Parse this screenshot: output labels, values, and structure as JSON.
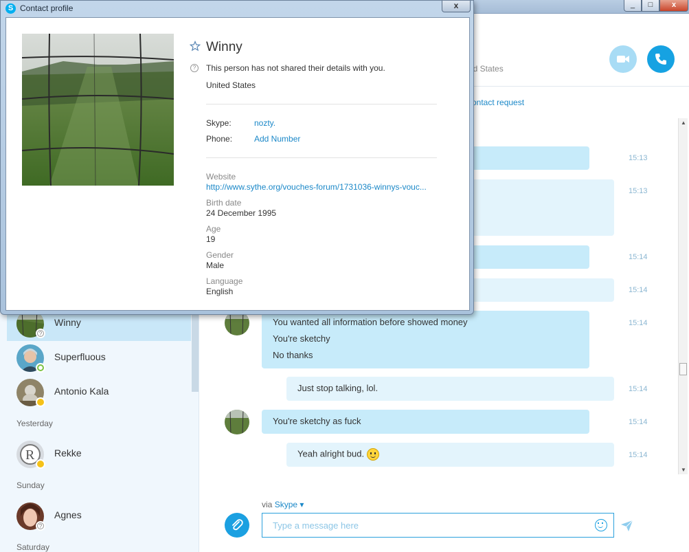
{
  "dialog": {
    "title": "Contact profile",
    "close_glyph": "x",
    "contact": {
      "name": "Winny",
      "details_notice": "This person has not shared their details with you.",
      "country": "United States",
      "skype_label": "Skype:",
      "skype_value": "nozty.",
      "phone_label": "Phone:",
      "phone_action": "Add Number",
      "website_label": "Website",
      "website_value": "http://www.sythe.org/vouches-forum/1731036-winnys-vouc...",
      "birthdate_label": "Birth date",
      "birthdate_value": "24 December 1995",
      "age_label": "Age",
      "age_value": "19",
      "gender_label": "Gender",
      "gender_value": "Male",
      "language_label": "Language",
      "language_value": "English"
    }
  },
  "main_window": {
    "controls": {
      "minimize": "_",
      "maximize": "□",
      "close": "x"
    },
    "header_peek": {
      "country": "ed States",
      "request": "ontact request"
    }
  },
  "sidebar": {
    "contacts_top": [
      {
        "name": "Winny",
        "status": "unknown"
      },
      {
        "name": "Superfluous",
        "status": "online"
      },
      {
        "name": "Antonio Kala",
        "status": "away"
      }
    ],
    "group_yesterday": "Yesterday",
    "contact_rekke": {
      "name": "Rekke",
      "status": "away"
    },
    "group_sunday": "Sunday",
    "contact_agnes": {
      "name": "Agnes",
      "status": "unknown"
    },
    "group_saturday": "Saturday"
  },
  "conversation": {
    "times": [
      "15:13",
      "15:13",
      "15:14",
      "15:14",
      "15:14",
      "15:14",
      "15:14",
      "15:14"
    ],
    "msg5_lines": [
      "You wanted all information before showed money",
      "You're sketchy",
      "No thanks"
    ],
    "msg6": "Just stop talking, lol.",
    "msg7": "You're sketchy as fuck",
    "msg8": "Yeah alright bud."
  },
  "composer": {
    "via_label": "via",
    "service": "Skype",
    "placeholder": "Type a message here"
  },
  "colors": {
    "accent": "#1ba0e1",
    "link": "#1b88c8",
    "incoming_bubble": "#c7ebfa",
    "outgoing_bubble": "#e3f4fc",
    "timestamp": "#8cb7d2"
  },
  "icons": [
    "skype-logo-icon",
    "star-icon",
    "question-icon",
    "video-call-icon",
    "phone-call-icon",
    "paperclip-icon",
    "emoji-icon",
    "send-icon",
    "dropdown-caret-icon",
    "smiley-emoticon-icon"
  ]
}
